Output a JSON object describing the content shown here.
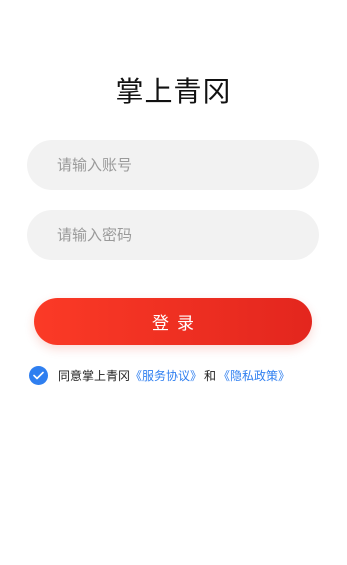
{
  "app": {
    "title": "掌上青冈"
  },
  "form": {
    "account_placeholder": "请输入账号",
    "password_placeholder": "请输入密码",
    "login_label": "登录"
  },
  "agreement": {
    "checked": true,
    "prefix": "同意掌上青冈",
    "service_link": "《服务协议》",
    "and": "和",
    "privacy_link": "《隐私政策》"
  },
  "colors": {
    "accent_red": "#e3261e",
    "link_blue": "#2f7ff0",
    "field_bg": "#f2f2f2"
  }
}
